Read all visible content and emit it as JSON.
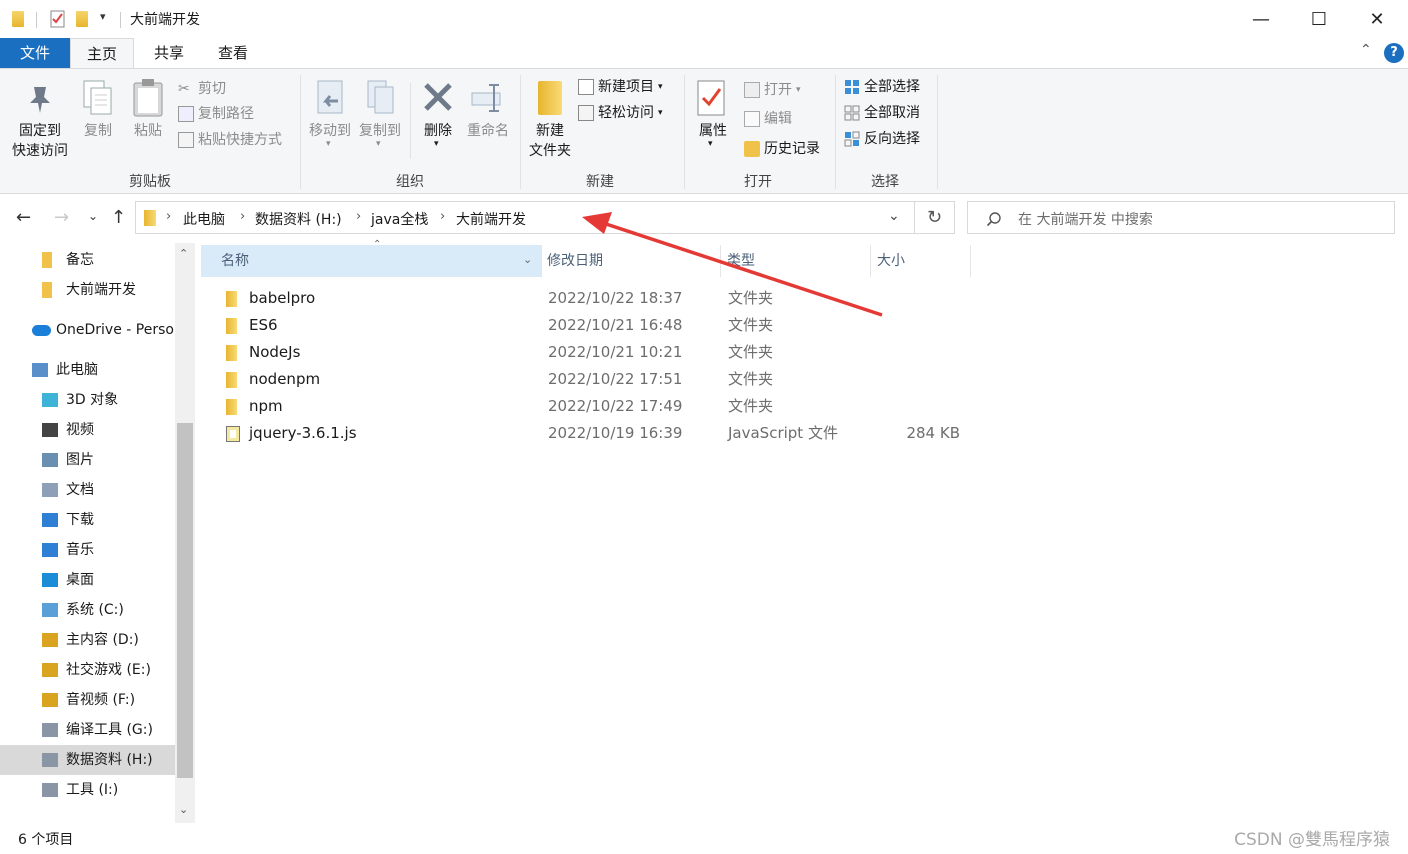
{
  "window": {
    "title": "大前端开发",
    "controls": {
      "minimize": "—",
      "maximize": "☐",
      "close": "✕"
    }
  },
  "ribbon": {
    "tabs": [
      "文件",
      "主页",
      "共享",
      "查看"
    ],
    "groups": {
      "clipboard": {
        "label": "剪贴板",
        "pin": [
          "固定到",
          "快速访问"
        ],
        "copy": "复制",
        "paste": "粘贴",
        "cut": "剪切",
        "copy_path": "复制路径",
        "paste_shortcut": "粘贴快捷方式"
      },
      "organize": {
        "label": "组织",
        "move_to": "移动到",
        "copy_to": "复制到",
        "delete": "删除",
        "rename": "重命名"
      },
      "new": {
        "label": "新建",
        "new_folder": [
          "新建",
          "文件夹"
        ],
        "new_item": "新建项目",
        "easy_access": "轻松访问"
      },
      "open": {
        "label": "打开",
        "properties": "属性",
        "open": "打开",
        "edit": "编辑",
        "history": "历史记录"
      },
      "select": {
        "label": "选择",
        "select_all": "全部选择",
        "select_none": "全部取消",
        "invert": "反向选择"
      }
    }
  },
  "address": {
    "crumbs": [
      "此电脑",
      "数据资料 (H:)",
      "java全栈",
      "大前端开发"
    ],
    "search_placeholder": "在 大前端开发 中搜索"
  },
  "nav_pane": {
    "items": [
      {
        "label": "备忘",
        "icon": "folder-icon",
        "indent": 1
      },
      {
        "label": "大前端开发",
        "icon": "folder-icon",
        "indent": 1
      },
      {
        "label": "OneDrive - Perso",
        "icon": "onedrive-icon",
        "indent": 0
      },
      {
        "label": "此电脑",
        "icon": "computer-icon",
        "indent": 0
      },
      {
        "label": "3D 对象",
        "icon": "3d-objects-icon",
        "indent": 1
      },
      {
        "label": "视频",
        "icon": "video-icon",
        "indent": 1
      },
      {
        "label": "图片",
        "icon": "pictures-icon",
        "indent": 1
      },
      {
        "label": "文档",
        "icon": "documents-icon",
        "indent": 1
      },
      {
        "label": "下载",
        "icon": "download-icon",
        "indent": 1
      },
      {
        "label": "音乐",
        "icon": "music-icon",
        "indent": 1
      },
      {
        "label": "桌面",
        "icon": "desktop-icon",
        "indent": 1
      },
      {
        "label": "系统 (C:)",
        "icon": "system-drive-icon",
        "indent": 1
      },
      {
        "label": "主内容 (D:)",
        "icon": "drive-warning-icon",
        "indent": 1
      },
      {
        "label": "社交游戏 (E:)",
        "icon": "drive-warning-icon",
        "indent": 1
      },
      {
        "label": "音视频 (F:)",
        "icon": "drive-warning-icon",
        "indent": 1
      },
      {
        "label": "编译工具 (G:)",
        "icon": "drive-icon",
        "indent": 1
      },
      {
        "label": "数据资料 (H:)",
        "icon": "drive-icon",
        "indent": 1,
        "selected": true
      },
      {
        "label": "工具 (I:)",
        "icon": "drive-icon",
        "indent": 1
      }
    ]
  },
  "list": {
    "columns": {
      "name": "名称",
      "modified": "修改日期",
      "type": "类型",
      "size": "大小"
    },
    "rows": [
      {
        "name": "babelpro",
        "modified": "2022/10/22 18:37",
        "type": "文件夹",
        "size": "",
        "icon": "folder-icon"
      },
      {
        "name": "ES6",
        "modified": "2022/10/21 16:48",
        "type": "文件夹",
        "size": "",
        "icon": "folder-icon"
      },
      {
        "name": "NodeJs",
        "modified": "2022/10/21 10:21",
        "type": "文件夹",
        "size": "",
        "icon": "folder-icon"
      },
      {
        "name": "nodenpm",
        "modified": "2022/10/22 17:51",
        "type": "文件夹",
        "size": "",
        "icon": "folder-icon"
      },
      {
        "name": "npm",
        "modified": "2022/10/22 17:49",
        "type": "文件夹",
        "size": "",
        "icon": "folder-icon"
      },
      {
        "name": "jquery-3.6.1.js",
        "modified": "2022/10/19 16:39",
        "type": "JavaScript 文件",
        "size": "284 KB",
        "icon": "js-file-icon"
      }
    ]
  },
  "status": {
    "count": "6 个项目",
    "watermark": "CSDN @雙馬程序猿"
  },
  "colors": {
    "file_tab": "#1a6fc1",
    "selection": "#d9ebf9",
    "arrow": "#e53935"
  }
}
